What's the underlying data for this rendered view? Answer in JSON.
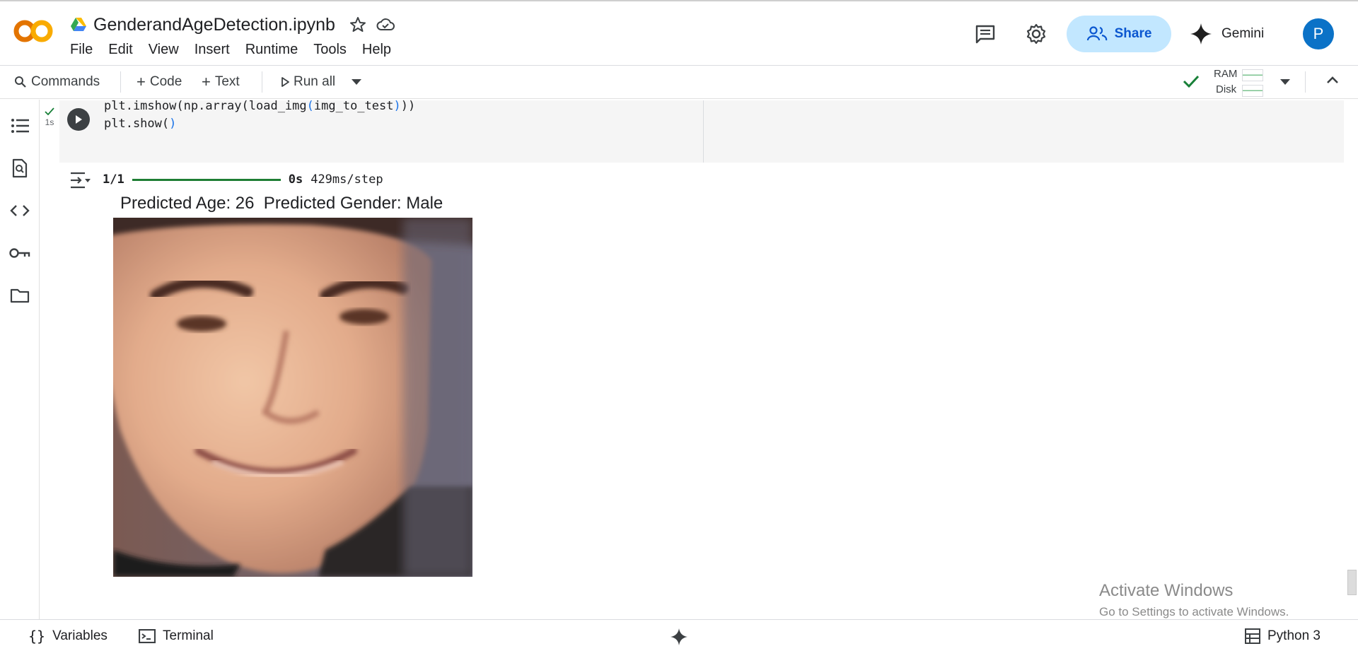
{
  "header": {
    "title": "GenderandAgeDetection.ipynb",
    "logo_text": "CO",
    "menu": [
      "File",
      "Edit",
      "View",
      "Insert",
      "Runtime",
      "Tools",
      "Help"
    ],
    "share_label": "Share",
    "gemini_label": "Gemini",
    "avatar_letter": "P"
  },
  "toolbar": {
    "commands_label": "Commands",
    "code_label": "Code",
    "text_label": "Text",
    "run_all_label": "Run all",
    "ram_label": "RAM",
    "disk_label": "Disk"
  },
  "cell": {
    "exec_time": "1s",
    "code_lines": [
      "plt.imshow(np.array(load_img(img_to_test)))",
      "plt.show()"
    ]
  },
  "output": {
    "step_count": "1/1",
    "step_time": "0s",
    "step_rate": "429ms/step",
    "progress": 1.0,
    "plot_title": "Predicted Age: 26  Predicted Gender: Male"
  },
  "watermark": {
    "line1": "Activate Windows",
    "line2": "Go to Settings to activate Windows."
  },
  "statusbar": {
    "variables_label": "Variables",
    "terminal_label": "Terminal",
    "runtime_label": "Python 3"
  },
  "colors": {
    "accent": "#0b57d0",
    "share_bg": "#c2e7ff",
    "logo_orange": "#f9ab00",
    "logo_dark_orange": "#e37400",
    "progress_green": "#1e7e34",
    "check_green": "#188038"
  }
}
